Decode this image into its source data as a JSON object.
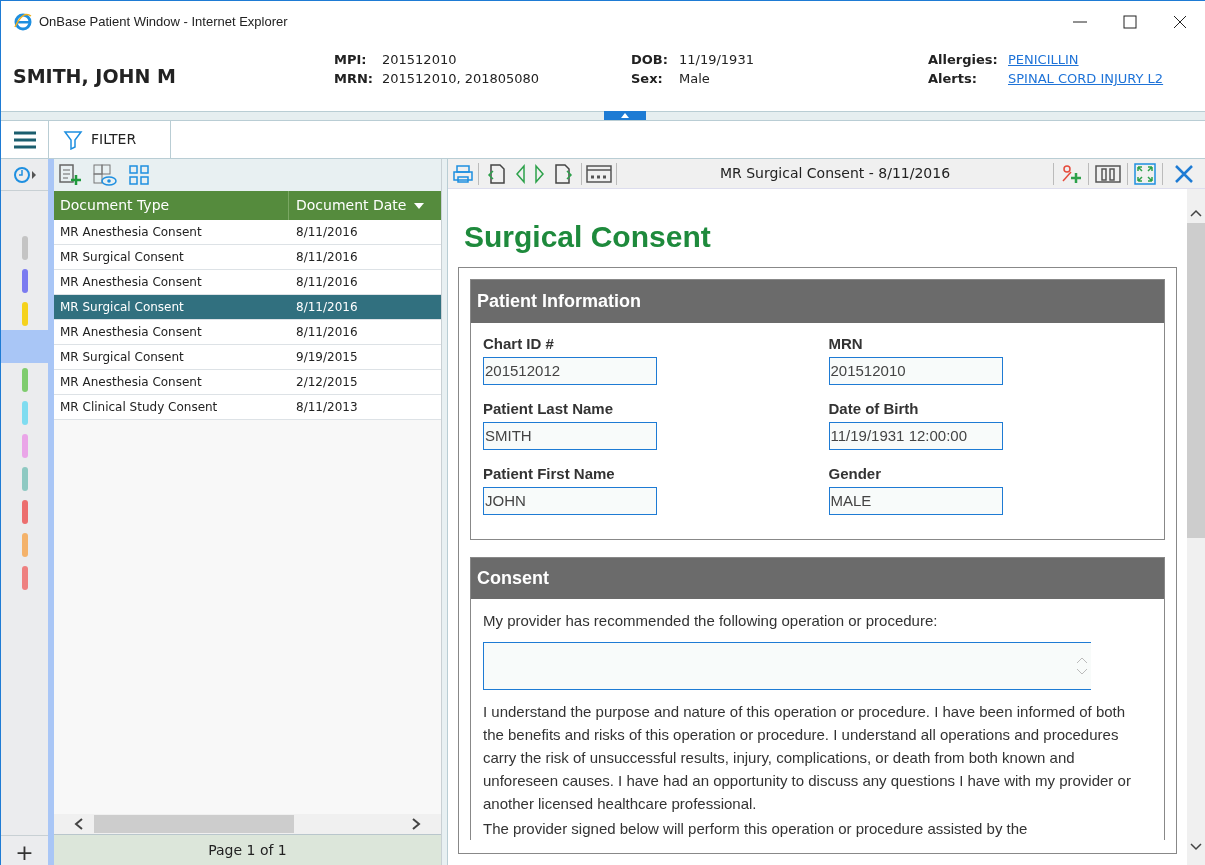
{
  "window": {
    "title": "OnBase Patient Window - Internet Explorer"
  },
  "patient": {
    "name": "SMITH, JOHN M",
    "fields": [
      {
        "label": "MPI:",
        "value": "201512010"
      },
      {
        "label": "MRN:",
        "value": "201512010, 201805080"
      },
      {
        "label": "DOB:",
        "value": "11/19/1931"
      },
      {
        "label": "Sex:",
        "value": "Male"
      },
      {
        "label": "Allergies:",
        "value": "PENICILLIN",
        "kind": "link"
      },
      {
        "label": "Alerts:",
        "value": "SPINAL CORD INJURY L2",
        "kind": "link"
      }
    ]
  },
  "toolbar": {
    "filter": "FILTER"
  },
  "rail": {
    "items": [
      {
        "color": "#c4c4c4",
        "selected": false
      },
      {
        "color": "#7b7bf0",
        "selected": false
      },
      {
        "color": "#f5d21c",
        "selected": false
      },
      {
        "selected": true
      },
      {
        "color": "#7fcc6e",
        "selected": false
      },
      {
        "color": "#7fdcf0",
        "selected": false
      },
      {
        "color": "#eaa5e8",
        "selected": false
      },
      {
        "color": "#8ec9c2",
        "selected": false
      },
      {
        "color": "#ec6e6e",
        "selected": false
      },
      {
        "color": "#f4b26a",
        "selected": false
      },
      {
        "color": "#ee8080",
        "selected": false
      }
    ],
    "add": "+"
  },
  "table": {
    "columns": [
      "Document Type",
      "Document Date"
    ],
    "rows": [
      {
        "type": "MR Anesthesia Consent",
        "date": "8/11/2016",
        "selected": false
      },
      {
        "type": "MR Surgical Consent",
        "date": "8/11/2016",
        "selected": false
      },
      {
        "type": "MR Anesthesia Consent",
        "date": "8/11/2016",
        "selected": false
      },
      {
        "type": "MR Surgical Consent",
        "date": "8/11/2016",
        "selected": true
      },
      {
        "type": "MR Anesthesia Consent",
        "date": "8/11/2016",
        "selected": false
      },
      {
        "type": "MR Surgical Consent",
        "date": "9/19/2015",
        "selected": false
      },
      {
        "type": "MR Anesthesia Consent",
        "date": "2/12/2015",
        "selected": false
      },
      {
        "type": "MR Clinical Study Consent",
        "date": "8/11/2013",
        "selected": false
      }
    ],
    "pager": "Page 1 of 1"
  },
  "viewer": {
    "title": "MR Surgical Consent - 8/11/2016",
    "document": {
      "heading": "Surgical Consent",
      "patient_section": {
        "title": "Patient Information",
        "fields": [
          {
            "label": "Chart ID #",
            "value": "201512012"
          },
          {
            "label": "MRN",
            "value": "201512010"
          },
          {
            "label": "Patient Last Name",
            "value": "SMITH"
          },
          {
            "label": "Date of Birth",
            "value": "11/19/1931 12:00:00"
          },
          {
            "label": "Patient First Name",
            "value": "JOHN"
          },
          {
            "label": "Gender",
            "value": "MALE"
          }
        ]
      },
      "consent_section": {
        "title": "Consent",
        "prompt": "My provider has recommended the following operation or procedure:",
        "paragraphs": [
          "I understand the purpose and nature of this operation or procedure. I have been informed of both the benefits and risks of this operation or procedure. I understand all operations and procedures carry the risk of unsuccessful results, injury, complications, or death from both known and unforeseen causes. I have had an opportunity to discuss any questions I have with my provider or another licensed healthcare professional.",
          "The provider signed below will perform this operation or procedure assisted by the"
        ]
      }
    }
  }
}
